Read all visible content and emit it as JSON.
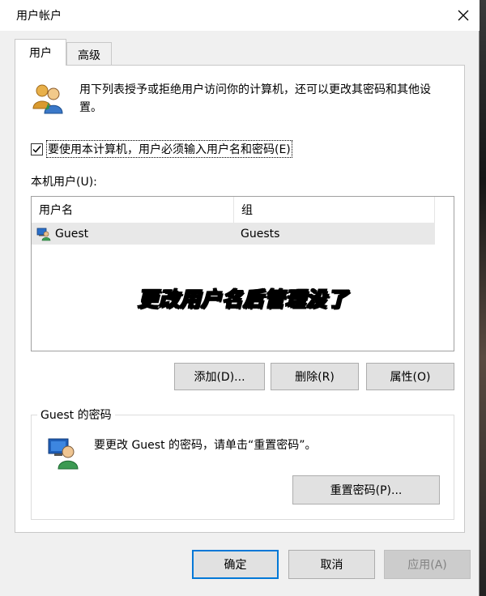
{
  "window": {
    "title": "用户帐户"
  },
  "tabs": [
    {
      "label": "用户",
      "active": true
    },
    {
      "label": "高级",
      "active": false
    }
  ],
  "intro_text": "用下列表授予或拒绝用户访问你的计算机，还可以更改其密码和其他设置。",
  "require_login": {
    "checked": true,
    "label": "要使用本计算机，用户必须输入用户名和密码(E)"
  },
  "local_users": {
    "label": "本机用户(U):",
    "columns": [
      "用户名",
      "组"
    ],
    "rows": [
      {
        "username": "Guest",
        "group": "Guests"
      }
    ]
  },
  "overlay_caption": "更改用户名后管理没了",
  "actions": {
    "add": "添加(D)...",
    "delete": "删除(R)",
    "properties": "属性(O)"
  },
  "password_group": {
    "title": "Guest 的密码",
    "message": "要更改 Guest 的密码，请单击“重置密码”。",
    "reset_button": "重置密码(P)..."
  },
  "dialog_buttons": {
    "ok": "确定",
    "cancel": "取消",
    "apply": "应用(A)"
  },
  "icons": {
    "title_close": "close-icon",
    "users": "users-icon",
    "user_row": "user-icon",
    "password": "user-password-icon",
    "checkbox": "checkmark-icon"
  },
  "colors": {
    "accent": "#0078d7",
    "button_face": "#e1e1e1",
    "dialog_bg": "#f0f0f0",
    "selection": "#e8e8e8"
  }
}
